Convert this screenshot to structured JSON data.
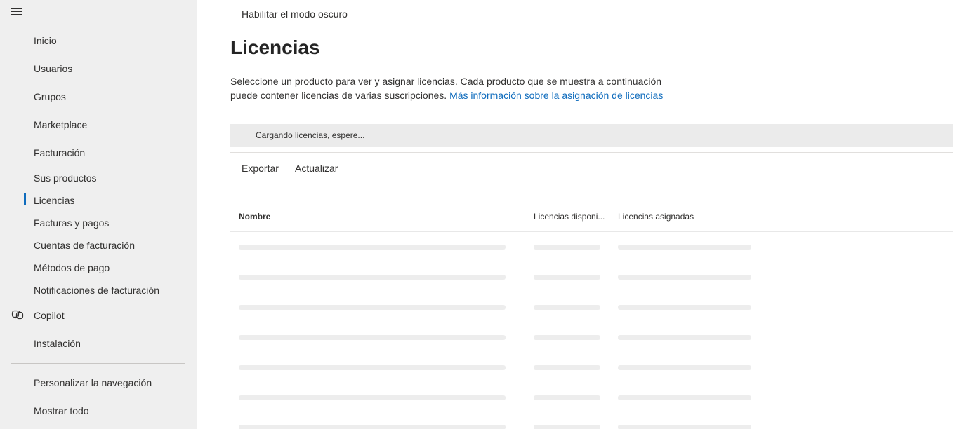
{
  "sidebar": {
    "items": [
      {
        "label": "Inicio"
      },
      {
        "label": "Usuarios"
      },
      {
        "label": "Grupos"
      },
      {
        "label": "Marketplace"
      },
      {
        "label": "Facturación"
      },
      {
        "label": "Sus productos"
      },
      {
        "label": "Licencias",
        "active": true
      },
      {
        "label": "Facturas y pagos"
      },
      {
        "label": "Cuentas de facturación"
      },
      {
        "label": "Métodos de pago"
      },
      {
        "label": "Notificaciones de facturación"
      },
      {
        "label": "Copilot",
        "icon": "copilot-icon"
      },
      {
        "label": "Instalación"
      }
    ],
    "footer": [
      {
        "label": "Personalizar la navegación"
      },
      {
        "label": "Mostrar todo"
      }
    ]
  },
  "header": {
    "dark_mode_label": "Habilitar el modo oscuro"
  },
  "main": {
    "title": "Licencias",
    "description": "Seleccione un producto para ver y asignar licencias. Cada producto que se muestra a continuación puede contener licencias de varias suscripciones.",
    "learn_more_link": "Más información sobre la asignación de licencias",
    "loading_text": "Cargando licencias, espere...",
    "commands": {
      "export": "Exportar",
      "refresh": "Actualizar"
    },
    "table": {
      "columns": [
        "Nombre",
        "Licencias disponi...",
        "Licencias asignadas"
      ]
    }
  },
  "colors": {
    "accent": "#0f6cbd",
    "sidebar_bg": "#efefef",
    "loading_bg": "#ebebeb",
    "shimmer": "#ededed"
  }
}
